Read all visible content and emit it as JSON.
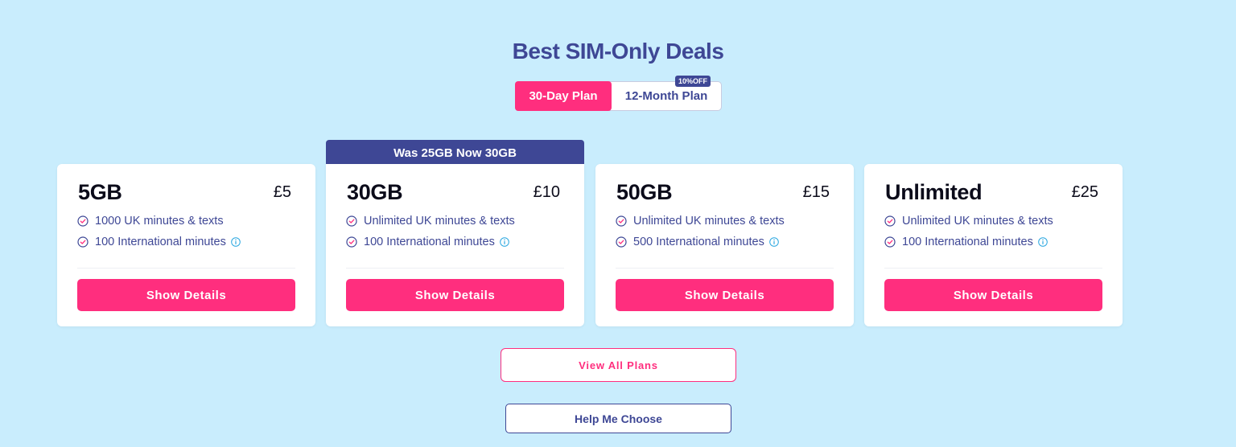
{
  "title": "Best SIM-Only Deals",
  "toggle": {
    "options": [
      {
        "label": "30-Day Plan",
        "active": true
      },
      {
        "label": "12-Month Plan",
        "active": false,
        "badge": "10%OFF"
      }
    ]
  },
  "promo_banner": "Was 25GB Now 30GB",
  "plans": [
    {
      "data": "5GB",
      "price": "£5",
      "features": [
        "1000 UK minutes & texts",
        "100 International minutes"
      ],
      "button": "Show Details"
    },
    {
      "data": "30GB",
      "price": "£10",
      "features": [
        "Unlimited UK minutes & texts",
        "100 International minutes"
      ],
      "button": "Show Details"
    },
    {
      "data": "50GB",
      "price": "£15",
      "features": [
        "Unlimited UK minutes & texts",
        "500 International minutes"
      ],
      "button": "Show Details"
    },
    {
      "data": "Unlimited",
      "price": "£25",
      "features": [
        "Unlimited UK minutes & texts",
        "100 International minutes"
      ],
      "button": "Show Details"
    }
  ],
  "view_all_label": "View All Plans",
  "help_label": "Help Me Choose",
  "colors": {
    "background": "#c9edfd",
    "brand_pink": "#ff2e7e",
    "brand_navy": "#3e4795",
    "info_blue": "#2aa7e0"
  },
  "icons": {
    "feature": "check-circle-icon",
    "info": "info-icon"
  }
}
